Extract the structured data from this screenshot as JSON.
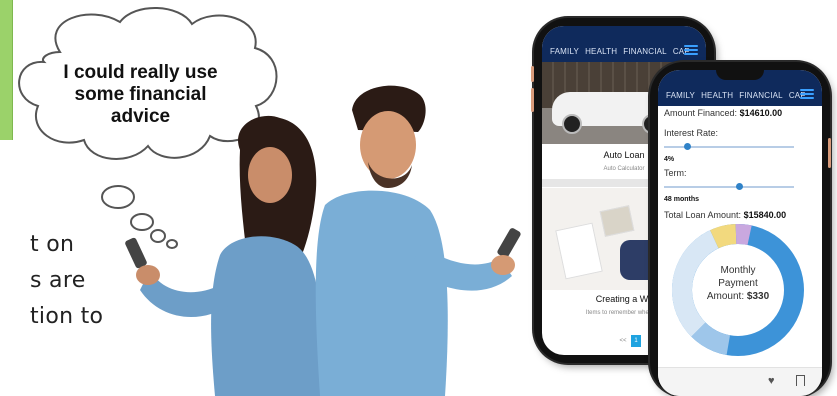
{
  "thought_bubble": {
    "text": "I could really use some financial advice"
  },
  "partial_text": {
    "line1": "t on",
    "line2": "s are",
    "line3": "tion to"
  },
  "back_phone": {
    "nav_tabs": [
      "FAMILY",
      "HEALTH",
      "FINANCIAL",
      "CAF"
    ],
    "card1_title": "Auto Loan",
    "card1_subtitle": "Auto Calculator",
    "card2_title": "Creating a Wil",
    "card2_subtitle": "Items to remember when cre",
    "pager": [
      "<<",
      "1"
    ]
  },
  "front_phone": {
    "nav_tabs": [
      "FAMILY",
      "HEALTH",
      "FINANCIAL",
      "CAF"
    ],
    "amount_financed_label": "Amount Financed:",
    "amount_financed_value": "$14610.00",
    "interest_rate_label": "Interest Rate:",
    "interest_rate_value": "4%",
    "interest_rate_level": 0.15,
    "term_label": "Term:",
    "term_value": "48 months",
    "term_level": 0.55,
    "total_loan_label": "Total Loan Amount:",
    "total_loan_value": "$15840.00",
    "donut_line1": "Monthly",
    "donut_line2": "Payment",
    "donut_line3": "Amount:",
    "donut_value": "$330",
    "donut_colors": [
      "#3d93d8",
      "#9ec6ea",
      "#d8e7f5",
      "#f2d97e",
      "#c9a8df"
    ]
  }
}
